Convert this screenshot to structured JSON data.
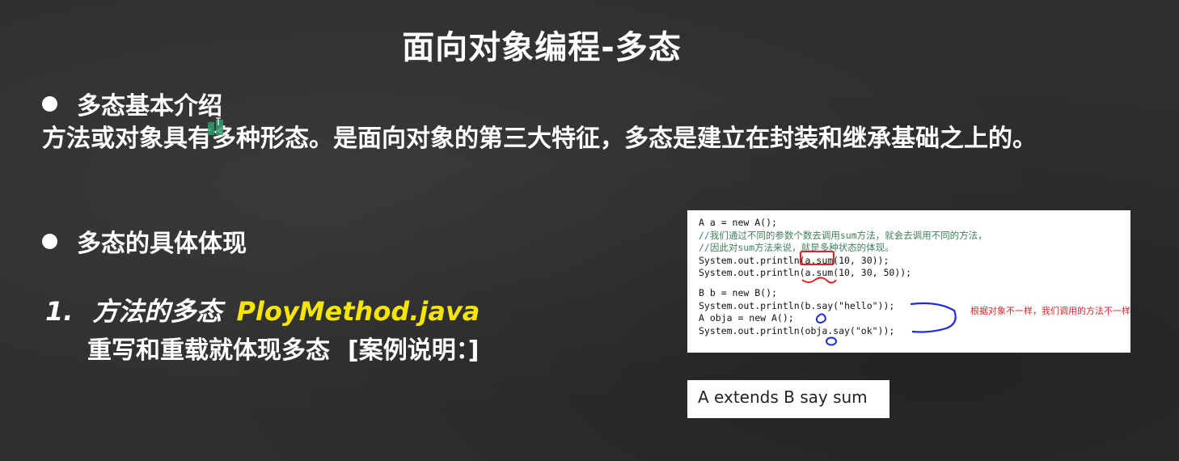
{
  "title": "面向对象编程-多态",
  "section1": {
    "heading": "多态基本介绍",
    "description": "方法或对象具有多种形态。是面向对象的第三大特征，多态是建立在封装和继承基础之上的。"
  },
  "section2": {
    "heading": "多态的具体体现",
    "item1": {
      "number": "1.",
      "label": "方法的多态",
      "filename": "PloyMethod.java",
      "subtitle": "重写和重载就体现多态",
      "bracket_note": "[案例说明：]"
    }
  },
  "code_example": {
    "lines": [
      "A a = new A();",
      "//我们通过不同的参数个数去调用sum方法，就会去调用不同的方法，",
      "//因此对sum方法来说，就是多种状态的体现。",
      "System.out.println(a.sum(10, 30));",
      "System.out.println(a.sum(10, 30, 50));",
      "",
      "B b = new B();",
      "System.out.println(b.say(\"hello\"));",
      "A obja = new A();",
      "System.out.println(obja.say(\"ok\"));"
    ],
    "annotation_note": "根据对象不一样，我们调用的方法不一样"
  },
  "extends_note": "A extends B  say  sum",
  "colors": {
    "background": "#2f2f2f",
    "highlight_yellow": "#f5e500",
    "annotation_red": "#d9252a",
    "annotation_blue": "#1f2bd8",
    "comment_green": "#3f7f5f"
  }
}
